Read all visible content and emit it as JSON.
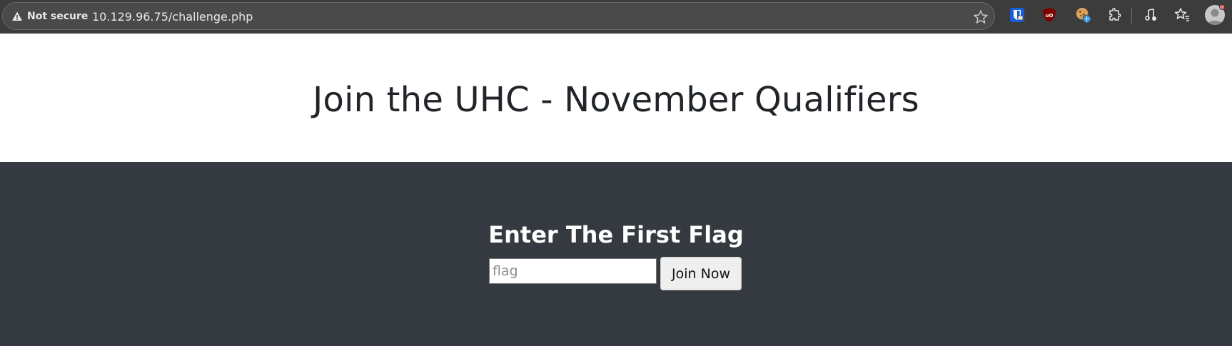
{
  "browser": {
    "security_label": "Not secure",
    "url": "10.129.96.75/challenge.php",
    "colors": {
      "toolbar": "#3c3c3c",
      "omnibox": "#4a4a4a"
    },
    "extensions": [
      {
        "icon": "bitwarden-icon"
      },
      {
        "icon": "ublock-origin-icon"
      },
      {
        "icon": "cookie-editor-icon"
      },
      {
        "icon": "extensions-puzzle-icon"
      },
      {
        "icon": "media-controls-icon"
      },
      {
        "icon": "favorites-icon"
      },
      {
        "icon": "profile-avatar-icon"
      }
    ]
  },
  "page": {
    "heading": "Join the UHC - November Qualifiers",
    "form": {
      "title": "Enter The First Flag",
      "input_value": "",
      "input_placeholder": "flag",
      "submit_label": "Join Now"
    },
    "colors": {
      "hero_bg": "#ffffff",
      "section_bg": "#343a40",
      "heading": "#212529"
    }
  }
}
